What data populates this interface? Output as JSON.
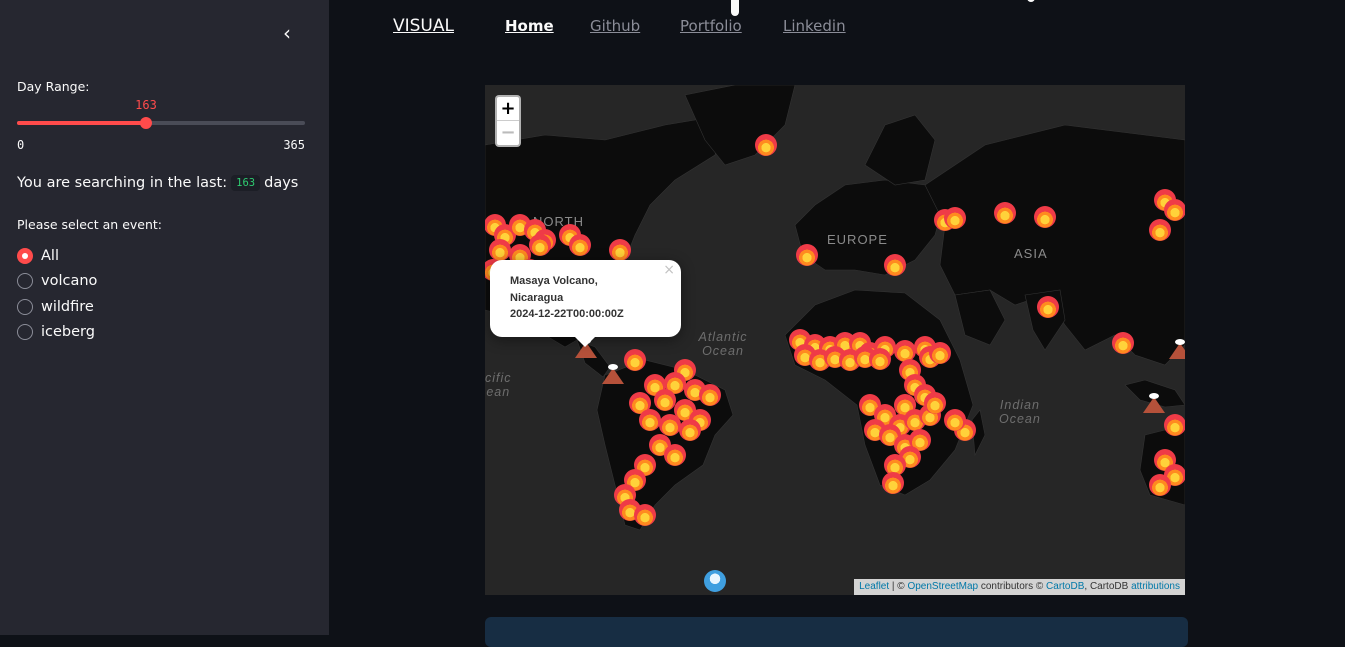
{
  "sidebar": {
    "collapse_icon": "chevron-left-icon",
    "collapse_glyph": "‹",
    "day_range_label": "Day Range:",
    "slider": {
      "value": 163,
      "value_text": "163",
      "min": 0,
      "min_text": "0",
      "max": 365,
      "max_text": "365",
      "accent": "#ff4b4b"
    },
    "search_prefix": "You are searching in the last:",
    "search_days": "163",
    "search_suffix": "days",
    "event_label": "Please select an event:",
    "events": [
      {
        "label": "All",
        "selected": true
      },
      {
        "label": "volcano",
        "selected": false
      },
      {
        "label": "wildfire",
        "selected": false
      },
      {
        "label": "iceberg",
        "selected": false
      }
    ]
  },
  "nav": {
    "brand": "VISUAL",
    "links": [
      "Home",
      "Github",
      "Portfolio",
      "Linkedin"
    ]
  },
  "map": {
    "zoom_in": "+",
    "zoom_out": "−",
    "labels": {
      "north": "NORTH",
      "europe": "EUROPE",
      "asia": "ASIA",
      "atlantic_1": "Atlantic",
      "atlantic_2": "Ocean",
      "pacific_1": "cific",
      "pacific_2": "ean",
      "indian_1": "Indian",
      "indian_2": "Ocean"
    },
    "popup": {
      "line1": "Masaya Volcano,",
      "line2": "Nicaragua",
      "line3": "2024-12-22T00:00:00Z",
      "close": "×"
    },
    "attribution": {
      "leaflet": "Leaflet",
      "sep": " | © ",
      "osm": "OpenStreetMap",
      "contrib": " contributors © ",
      "cartodb": "CartoDB",
      "comma": ", CartoDB ",
      "attributions": "attributions"
    },
    "marker_types": [
      "fire-icon",
      "volcano-icon",
      "iceberg-icon"
    ]
  }
}
